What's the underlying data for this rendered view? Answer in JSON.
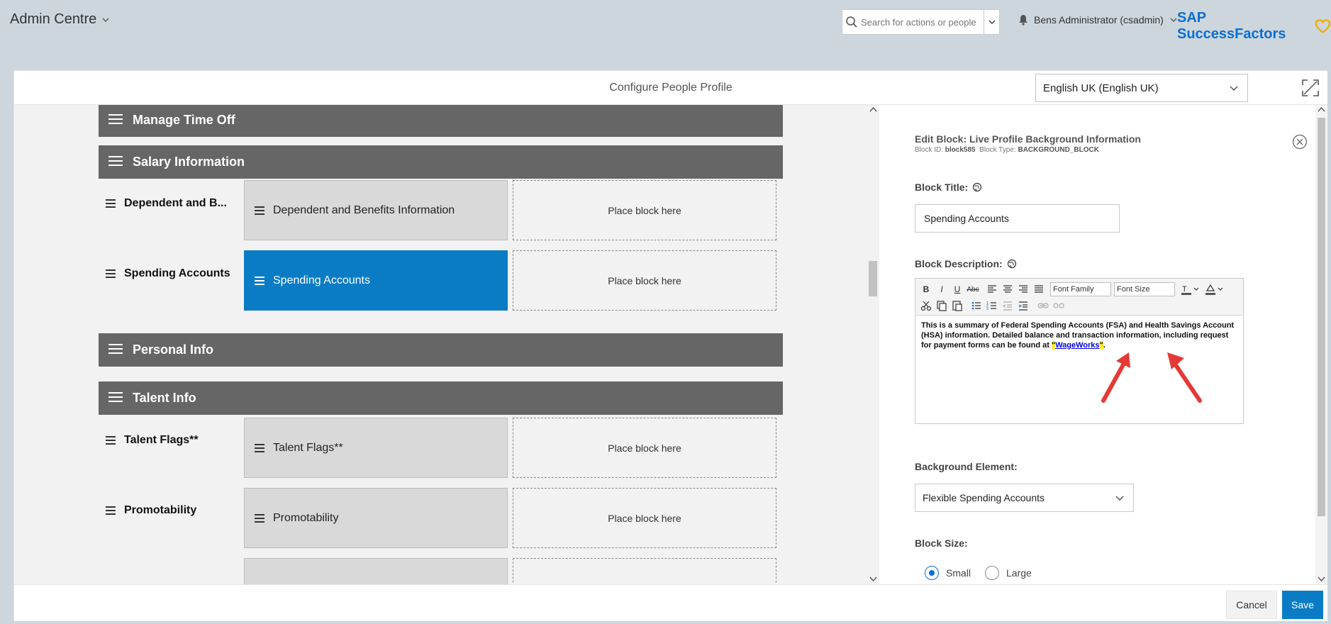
{
  "shell": {
    "app_title": "Admin Centre",
    "search_placeholder": "Search for actions or people",
    "user_name": "Bens Administrator (csadmin)",
    "brand": "SAP SuccessFactors",
    "brand_color": "#0a6ed1"
  },
  "panel": {
    "title": "Configure People Profile",
    "language": "English UK (English UK)"
  },
  "canvas": {
    "sections": [
      {
        "label": "Manage Time Off"
      },
      {
        "label": "Salary Information"
      },
      {
        "label": "Personal Info"
      },
      {
        "label": "Talent Info"
      }
    ],
    "rows": [
      {
        "label": "Dependent and B...",
        "block": "Dependent and Benefits Information",
        "placeholder": "Place block here"
      },
      {
        "label": "Spending Accounts",
        "block": "Spending Accounts",
        "placeholder": "Place block here"
      },
      {
        "label": "Talent Flags**",
        "block": "Talent Flags**",
        "placeholder": "Place block here"
      },
      {
        "label": "Promotability",
        "block": "Promotability",
        "placeholder": "Place block here"
      }
    ],
    "selected_color": "#0a7cc6"
  },
  "edit": {
    "title": "Edit Block: Live Profile Background Information",
    "block_id_label": "Block ID:",
    "block_id": "block585",
    "block_type_label": "Block Type:",
    "block_type": "BACKGROUND_BLOCK",
    "block_title_label": "Block Title:",
    "block_title_value": "Spending Accounts",
    "block_description_label": "Block Description:",
    "toolbar": {
      "font_family": "Font Family",
      "font_size": "Font Size"
    },
    "description_text": "This is a summary of Federal Spending Accounts (FSA) and Health Savings Account (HSA) information. Detailed balance and transaction information, including request for payment forms can be found at ",
    "description_link": "WageWorks",
    "description_end": ".",
    "background_element_label": "Background Element:",
    "background_element_value": "Flexible Spending Accounts",
    "block_size_label": "Block Size:",
    "size_small": "Small",
    "size_large": "Large"
  },
  "footer": {
    "cancel": "Cancel",
    "save": "Save"
  }
}
